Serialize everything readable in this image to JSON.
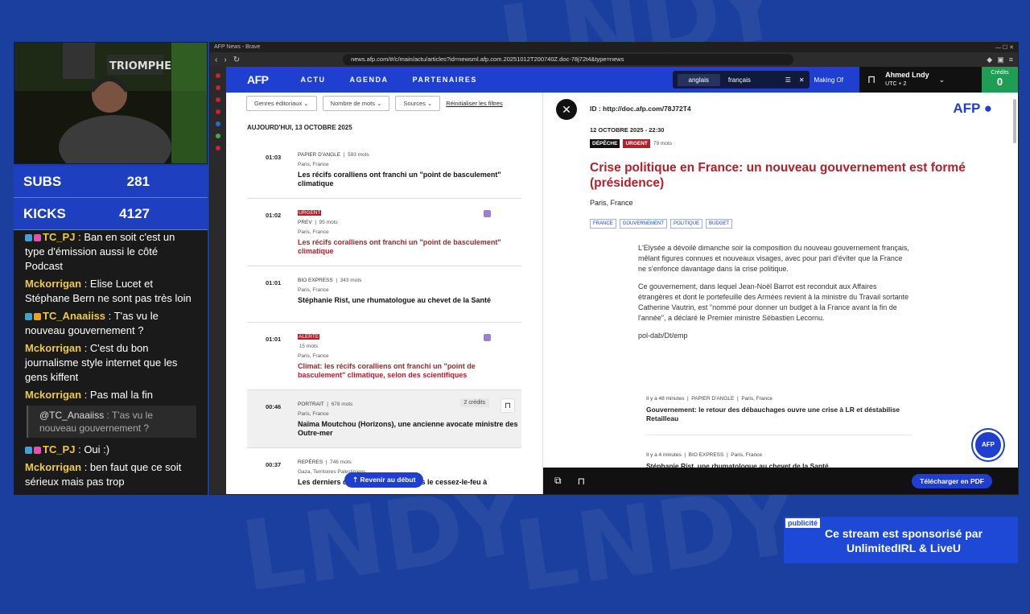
{
  "browser": {
    "title": "AFP News - Brave",
    "url": "news.afp.com/#/c/main/actu/articles?id=newsml.afp.com.20251012T200740Z.doc-78j72t4&type=news"
  },
  "stream": {
    "subs_label": "SUBS",
    "subs_value": "281",
    "kicks_label": "KICKS",
    "kicks_value": "4127",
    "chat": [
      {
        "user": "TC_PJ",
        "text": "Ban en soit c'est un type d'émission aussi le côté Podcast",
        "color": "#f0c84b"
      },
      {
        "user": "Mckorrigan",
        "text": "Elise Lucet et Stéphane Bern ne sont pas très loin",
        "color": "#f0c84b"
      },
      {
        "user": "TC_Anaaiiss",
        "text": "T'as vu le nouveau gouvernement ?",
        "color": "#f0c84b"
      },
      {
        "user": "Mckorrigan",
        "text": "C'est du bon journalisme style internet que les gens kiffent",
        "color": "#f0c84b"
      },
      {
        "user": "Mckorrigan",
        "text": "Pas mal la fin",
        "color": "#f0c84b"
      },
      {
        "reply_user": "@TC_Anaaiiss",
        "reply_text": "T'as vu le nouveau gouvernement ?"
      },
      {
        "user": "TC_PJ",
        "text": "Oui :)",
        "color": "#f0c84b"
      },
      {
        "user": "Mckorrigan",
        "text": "ben faut que ce soit sérieux mais pas trop",
        "color": "#f0c84b"
      }
    ],
    "ad_tag": "publicité",
    "ad_text": "Ce stream est sponsorisé par UnlimitedIRL & LiveU"
  },
  "afp": {
    "logo": "AFP",
    "nav": [
      "ACTU",
      "AGENDA",
      "PARTENAIRES"
    ],
    "lang_en": "anglais",
    "lang_fr": "français",
    "making_of": "Making Of",
    "user_name": "Ahmed Lndy",
    "user_tz": "UTC + 2",
    "credits_label": "Crédits",
    "credits_value": "0",
    "filters": [
      "Genres éditoriaux",
      "Nombre de mots",
      "Sources"
    ],
    "reset": "Réinitialiser les filtres",
    "day": "AUJOURD'HUI, 13 OCTOBRE 2025",
    "items": [
      {
        "time": "01:03",
        "type": "PAPIER D'ANGLE",
        "words": "593 mots",
        "place": "Paris, France",
        "title": "Les récifs coralliens ont franchi un \"point de basculement\" climatique"
      },
      {
        "time": "01:02",
        "tag": "URGENT",
        "type": "PREV",
        "words": "95 mots",
        "place": "Paris, France",
        "title": "Les récifs coralliens ont franchi un \"point de basculement\" climatique"
      },
      {
        "time": "01:01",
        "type": "BIO EXPRESS",
        "words": "343 mots",
        "place": "Paris, France",
        "title": "Stéphanie Rist, une rhumatologue au chevet de la Santé"
      },
      {
        "time": "01:01",
        "tag": "ALERTE",
        "words": "15 mots",
        "place": "Paris, France",
        "title": "Climat: les récifs coralliens ont franchi un \"point de basculement\" climatique, selon des scientifiques"
      },
      {
        "time": "00:46",
        "type": "PORTRAIT",
        "words": "678 mots",
        "place": "Paris, France",
        "title": "Naïma Moutchou (Horizons), une ancienne avocate ministre des Outre-mer",
        "credits": "2 crédits"
      },
      {
        "time": "00:37",
        "type": "REPÈRES",
        "words": "746 mots",
        "place": "Gaza, Territoires Palestiniens",
        "title": "Les derniers développements depuis le cessez-le-feu à"
      }
    ],
    "back_top": "Revenir au début",
    "article": {
      "id": "ID : http://doc.afp.com/78J72T4",
      "date": "12 OCTOBRE 2025 - 22:30",
      "tag1": "DÉPÊCHE",
      "tag2": "URGENT",
      "words": "79 mots",
      "title": "Crise politique en France: un nouveau gouvernement est formé (présidence)",
      "place": "Paris, France",
      "keywords": [
        "FRANCE",
        "GOUVERNEMENT",
        "POLITIQUE",
        "BUDGET"
      ],
      "p1": "L'Elysée a dévoilé dimanche soir la composition du nouveau gouvernement français, mêlant figures connues et nouveaux visages, avec pour pari d'éviter que la France ne s'enfonce davantage dans la crise politique.",
      "p2": "Ce gouvernement, dans lequel Jean-Noël Barrot est reconduit aux Affaires étrangères et dont le portefeuille des Armées revient à la ministre du Travail sortante Catherine Vautrin, est \"nommé pour donner un budget à la France avant la fin de l'année\", a déclaré le Premier ministre Sébastien Lecornu.",
      "p3": "pol-dab/Dt/emp",
      "related": [
        {
          "ago": "Il y a 48 minutes",
          "type": "PAPIER D'ANGLE",
          "place": "Paris, France",
          "title": "Gouvernement: le retour des débauchages ouvre une crise à LR et déstabilise Retailleau"
        },
        {
          "ago": "Il y a 4 minutes",
          "type": "BIO EXPRESS",
          "place": "Paris, France",
          "title": "Stéphanie Rist, une rhumatologue au chevet de la Santé"
        }
      ],
      "pdf": "Télécharger en PDF"
    }
  }
}
